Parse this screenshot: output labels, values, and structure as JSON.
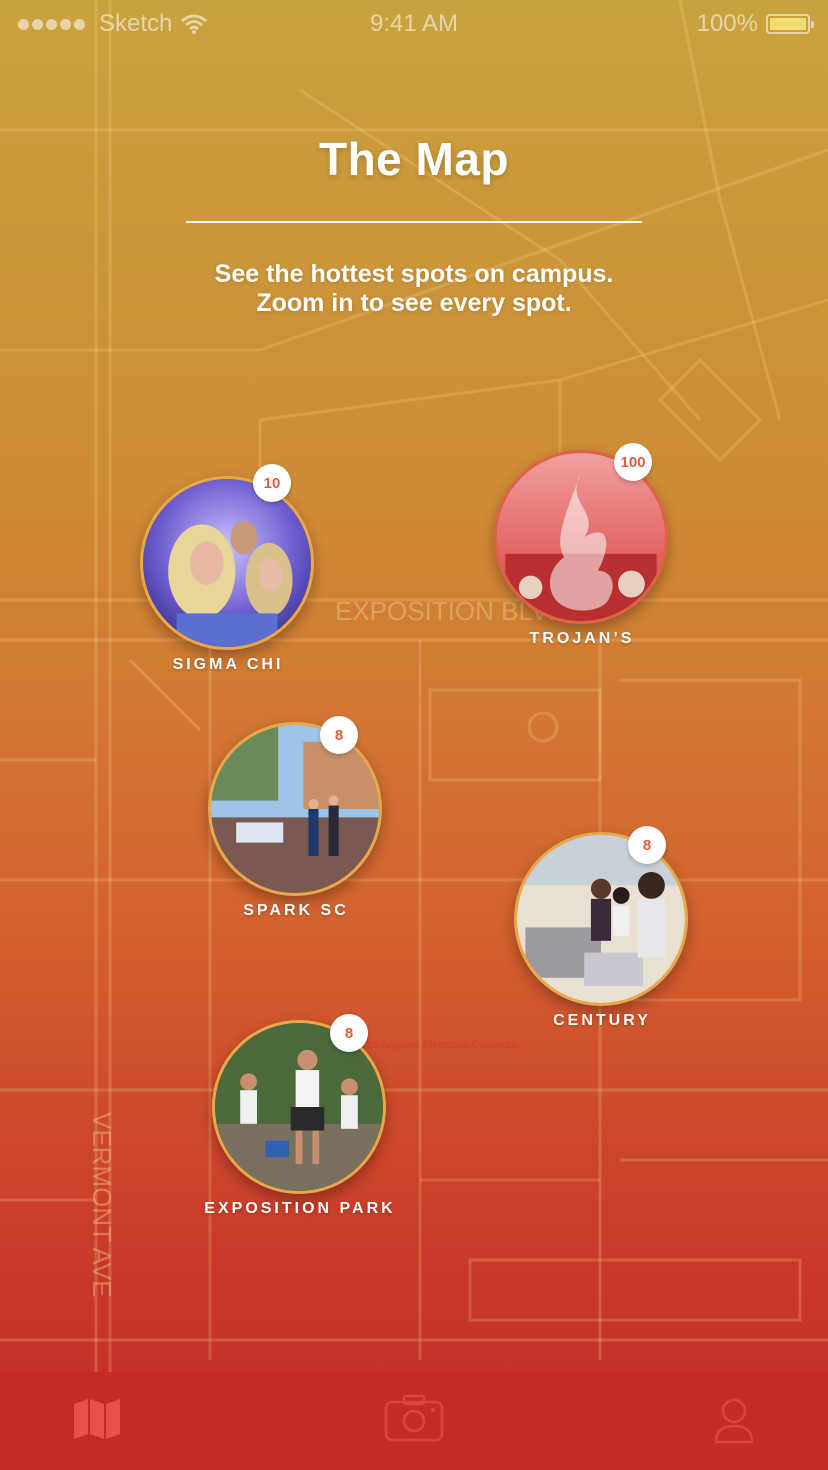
{
  "status_bar": {
    "carrier": "Sketch",
    "time": "9:41 AM",
    "battery": "100%",
    "signal_icon": "signal-dots-icon",
    "wifi_icon": "wifi-icon",
    "battery_icon": "battery-icon"
  },
  "header": {
    "title": "The Map",
    "subtitle_line1": "See the hottest spots on campus.",
    "subtitle_line2": "Zoom in to see every spot."
  },
  "map": {
    "street_labels": [
      "EXPOSITION BLVD",
      "VERMONT AVE",
      "Los Angeles Memorial Coliseum"
    ]
  },
  "spots": [
    {
      "name": "SIGMA CHI",
      "count": "10"
    },
    {
      "name": "TROJAN’S",
      "count": "100"
    },
    {
      "name": "SPARK SC",
      "count": "8"
    },
    {
      "name": "CENTURY",
      "count": "8"
    },
    {
      "name": "EXPOSITION PARK",
      "count": "8"
    }
  ],
  "tab_bar": {
    "tabs": [
      {
        "icon": "map-icon",
        "active": true
      },
      {
        "icon": "camera-icon",
        "active": false
      },
      {
        "icon": "profile-icon",
        "active": false
      }
    ]
  },
  "colors": {
    "gradient_top": "#c9a23e",
    "gradient_bottom": "#c12a26",
    "badge_text": "#e45c3e",
    "photo_ring": "#e8a84a",
    "tab_bar": "#c42b23"
  }
}
